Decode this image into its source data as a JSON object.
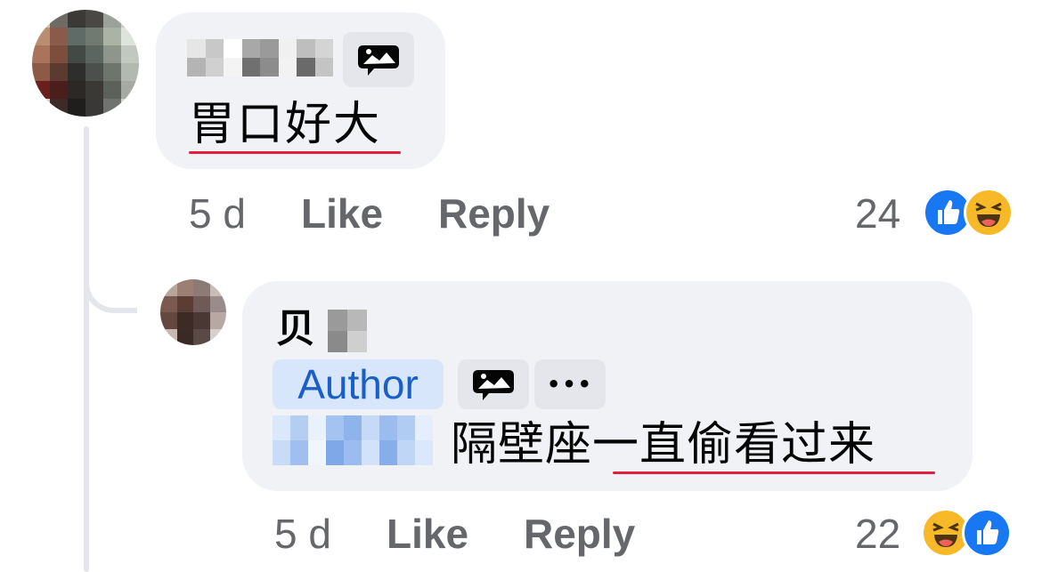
{
  "comment": {
    "text": "胃口好大",
    "time": "5 d",
    "like_label": "Like",
    "reply_label": "Reply",
    "reaction_count": "24",
    "reactions": [
      "like-icon",
      "haha-icon"
    ]
  },
  "reply": {
    "name_visible": "贝",
    "badge": "Author",
    "more_label": "•••",
    "text": "隔壁座一直偷看过来",
    "time": "5 d",
    "like_label": "Like",
    "reply_label": "Reply",
    "reaction_count": "22",
    "reactions": [
      "haha-icon",
      "like-icon"
    ]
  },
  "colors": {
    "bubble": "#f0f2f5",
    "secondary_text": "#65676b",
    "author_badge_bg": "#d8e6fb",
    "author_badge_text": "#1a5fc7",
    "like_blue": "#1877f2",
    "haha_yellow": "#f7b928",
    "spellcheck_red": "#e41e3f"
  }
}
